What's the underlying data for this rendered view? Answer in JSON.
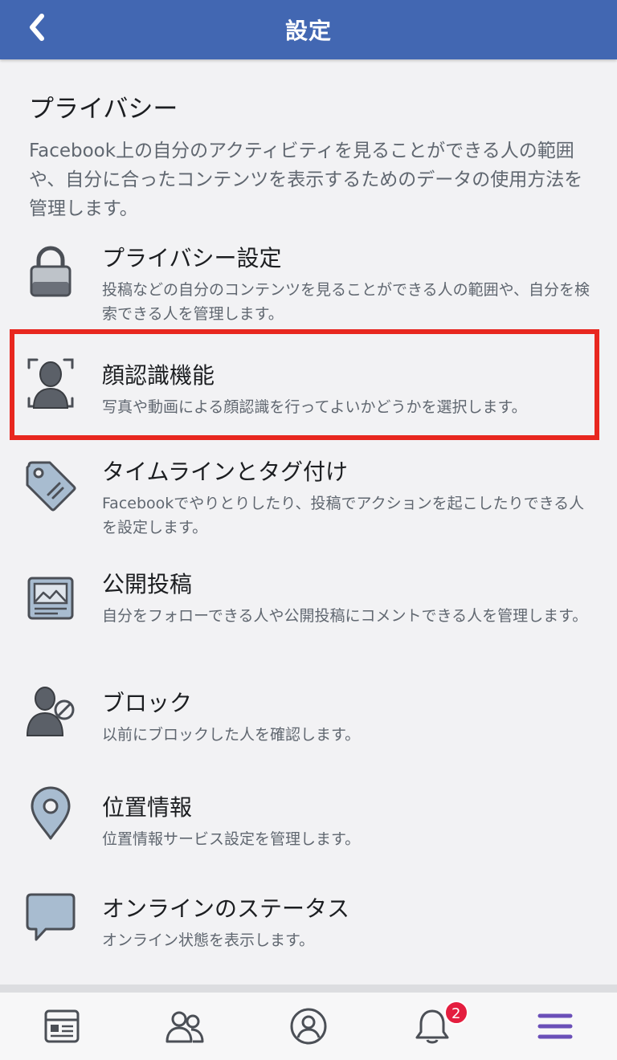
{
  "header": {
    "title": "設定",
    "back_icon": "chevron-left-icon",
    "bg_color": "#4267b2"
  },
  "section": {
    "title": "プライバシー",
    "description": "Facebook上の自分のアクティビティを見ることができる人の範囲や、自分に合ったコンテンツを表示するためのデータの使用方法を管理します。"
  },
  "items": [
    {
      "label": "プライバシー設定",
      "description": "投稿などの自分のコンテンツを見ることができる人の範囲や、自分を検索できる人を管理します。",
      "icon": "lock-icon"
    },
    {
      "label": "顔認識機能",
      "description": "写真や動画による顔認識を行ってよいかどうかを選択します。",
      "icon": "face-recognition-icon",
      "highlighted": true
    },
    {
      "label": "タイムラインとタグ付け",
      "description": "Facebookでやりとりしたり、投稿でアクションを起こしたりできる人を設定します。",
      "icon": "tag-icon"
    },
    {
      "label": "公開投稿",
      "description": "自分をフォローできる人や公開投稿にコメントできる人を管理します。",
      "icon": "public-post-icon"
    },
    {
      "label": "ブロック",
      "description": "以前にブロックした人を確認します。",
      "icon": "block-user-icon"
    },
    {
      "label": "位置情報",
      "description": "位置情報サービス設定を管理します。",
      "icon": "location-pin-icon"
    },
    {
      "label": "オンラインのステータス",
      "description": "オンライン状態を表示します。",
      "icon": "chat-bubble-icon"
    }
  ],
  "tabbar": {
    "tabs": [
      {
        "icon": "news-feed-icon"
      },
      {
        "icon": "friends-icon"
      },
      {
        "icon": "profile-icon"
      },
      {
        "icon": "notifications-bell-icon",
        "badge": "2"
      },
      {
        "icon": "menu-icon",
        "active": true
      }
    ],
    "active_color": "#6a4fb8",
    "badge_color": "#e41e3f"
  },
  "highlight_color": "#e8271f"
}
